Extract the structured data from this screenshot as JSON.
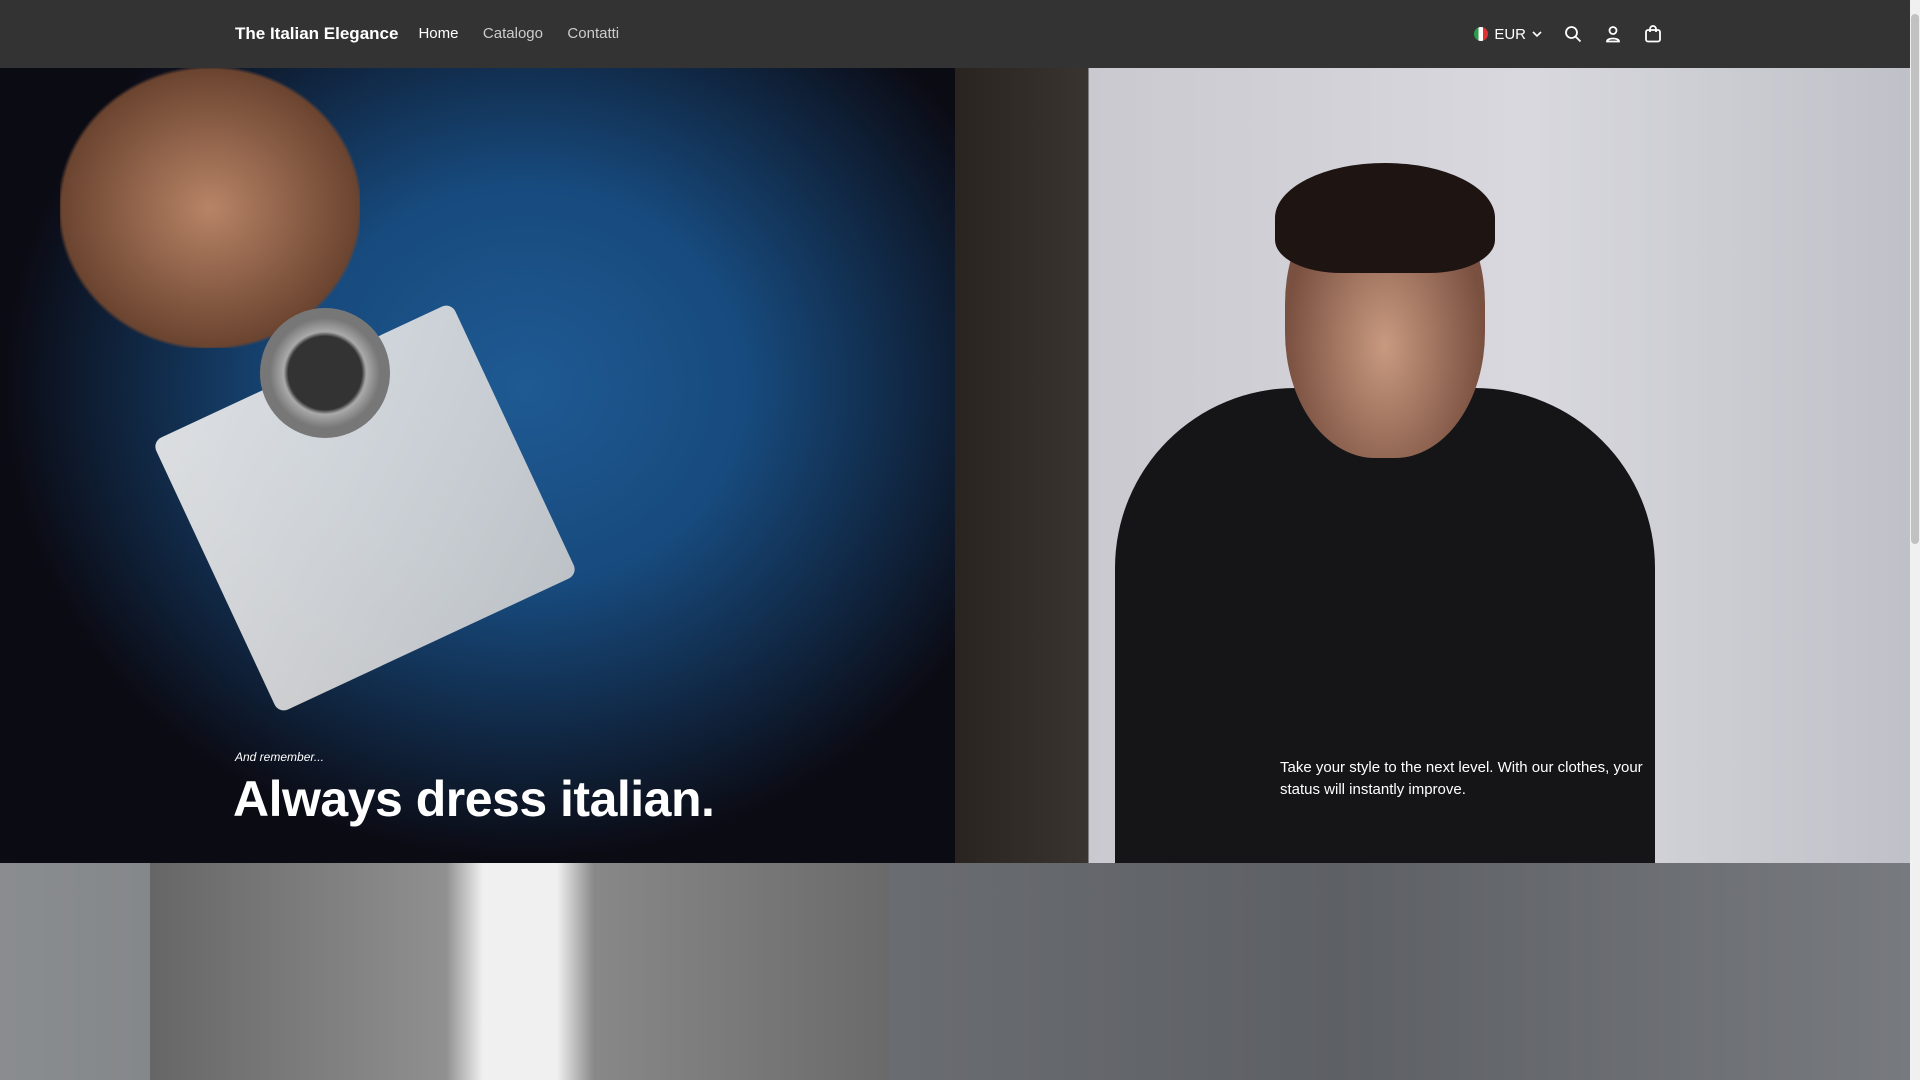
{
  "header": {
    "brand": "The Italian Elegance",
    "nav": [
      "Home",
      "Catalogo",
      "Contatti"
    ],
    "currency": "EUR"
  },
  "hero": {
    "tagline": "And remember...",
    "headline": "Always dress italian.",
    "description": "Take your style to the next level. With our clothes, your status will instantly improve."
  }
}
